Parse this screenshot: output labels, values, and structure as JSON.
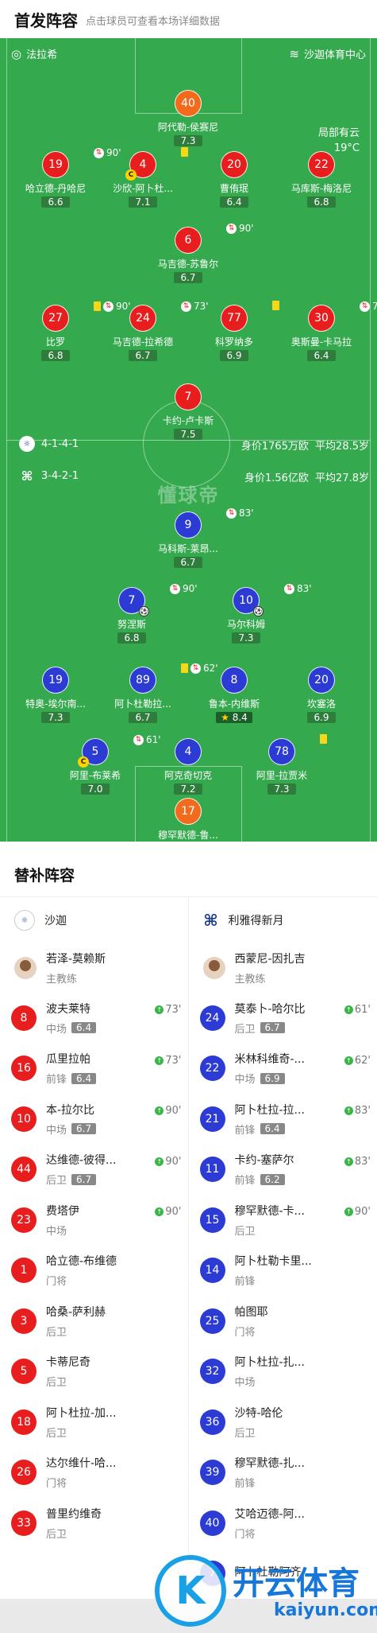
{
  "header": {
    "title": "首发阵容",
    "subtitle": "点击球员可查看本场详细数据"
  },
  "pitch": {
    "home_team_label": "法拉希",
    "venue": "沙迦体育中心",
    "weather": "局部有云",
    "temperature": "19°C",
    "watermark": "懂球帝"
  },
  "home_players": [
    {
      "num": "40",
      "name": "阿代勒-侯赛尼",
      "rating": "7.3",
      "color": "orange"
    },
    {
      "num": "19",
      "name": "哈立德-丹哈尼",
      "rating": "6.6",
      "color": "red",
      "sub": "90'"
    },
    {
      "num": "4",
      "name": "沙欣-阿卜杜...",
      "rating": "7.1",
      "color": "red",
      "yellow": true,
      "captain": "C"
    },
    {
      "num": "20",
      "name": "曹侑珉",
      "rating": "6.4",
      "color": "red"
    },
    {
      "num": "22",
      "name": "马库斯-梅洛尼",
      "rating": "6.8",
      "color": "red"
    },
    {
      "num": "6",
      "name": "马吉德-苏鲁尔",
      "rating": "6.7",
      "color": "red",
      "sub": "90'"
    },
    {
      "num": "27",
      "name": "比罗",
      "rating": "6.8",
      "color": "red",
      "yellow": true,
      "sub": "90'"
    },
    {
      "num": "24",
      "name": "马吉德-拉希德",
      "rating": "6.7",
      "color": "red",
      "sub": "73'"
    },
    {
      "num": "77",
      "name": "科罗纳多",
      "rating": "6.9",
      "color": "red",
      "yellow": true
    },
    {
      "num": "30",
      "name": "奥斯曼-卡马拉",
      "rating": "6.4",
      "color": "red",
      "sub": "73'"
    },
    {
      "num": "7",
      "name": "卡约-卢卡斯",
      "rating": "7.5",
      "color": "red"
    }
  ],
  "formations": {
    "home": {
      "formation": "4-1-4-1",
      "value": "身价1765万欧",
      "age": "平均28.5岁"
    },
    "away": {
      "formation": "3-4-2-1",
      "value": "身价1.56亿欧",
      "age": "平均27.8岁"
    }
  },
  "away_players": [
    {
      "num": "9",
      "name": "马科斯-莱昂...",
      "rating": "6.7",
      "color": "blue",
      "sub": "83'"
    },
    {
      "num": "7",
      "name": "努涅斯",
      "rating": "6.8",
      "color": "blue",
      "sub": "90'",
      "goal": true
    },
    {
      "num": "10",
      "name": "马尔科姆",
      "rating": "7.3",
      "color": "blue",
      "sub": "83'",
      "goal": true
    },
    {
      "num": "19",
      "name": "特奥-埃尔南...",
      "rating": "7.3",
      "color": "blue"
    },
    {
      "num": "89",
      "name": "阿卜杜勒拉...",
      "rating": "6.7",
      "color": "blue",
      "yellow": true,
      "sub": "62'"
    },
    {
      "num": "8",
      "name": "鲁本-内维斯",
      "rating": "8.4",
      "color": "blue",
      "star": true
    },
    {
      "num": "20",
      "name": "坎塞洛",
      "rating": "6.9",
      "color": "blue"
    },
    {
      "num": "5",
      "name": "阿里-布莱希",
      "rating": "7.0",
      "color": "blue",
      "sub": "61'",
      "captain": "C"
    },
    {
      "num": "4",
      "name": "阿克奇切克",
      "rating": "7.2",
      "color": "blue"
    },
    {
      "num": "78",
      "name": "阿里-拉贾米",
      "rating": "7.3",
      "color": "blue",
      "yellow": true
    },
    {
      "num": "17",
      "name": "穆罕默德-鲁...",
      "rating": "8.2",
      "color": "orange"
    }
  ],
  "bench": {
    "title": "替补阵容",
    "home": {
      "team": "沙迦",
      "coach": {
        "name": "若泽-莫赖斯",
        "role": "主教练"
      },
      "players": [
        {
          "num": "8",
          "name": "波夫莱特",
          "pos": "中场",
          "score": "6.4",
          "time": "73'"
        },
        {
          "num": "16",
          "name": "瓜里拉帕",
          "pos": "前锋",
          "score": "6.4",
          "time": "73'"
        },
        {
          "num": "10",
          "name": "本-拉尔比",
          "pos": "中场",
          "score": "6.7",
          "time": "90'"
        },
        {
          "num": "44",
          "name": "达维德-彼得...",
          "pos": "后卫",
          "score": "6.7",
          "time": "90'"
        },
        {
          "num": "23",
          "name": "费塔伊",
          "pos": "中场",
          "score": "",
          "time": "90'"
        },
        {
          "num": "1",
          "name": "哈立德-布维德",
          "pos": "门将",
          "score": "",
          "time": ""
        },
        {
          "num": "3",
          "name": "哈桑-萨利赫",
          "pos": "后卫",
          "score": "",
          "time": ""
        },
        {
          "num": "5",
          "name": "卡蒂尼奇",
          "pos": "后卫",
          "score": "",
          "time": ""
        },
        {
          "num": "18",
          "name": "阿卜杜拉-加...",
          "pos": "后卫",
          "score": "",
          "time": ""
        },
        {
          "num": "26",
          "name": "达尔维什-哈...",
          "pos": "门将",
          "score": "",
          "time": ""
        },
        {
          "num": "33",
          "name": "普里约维奇",
          "pos": "后卫",
          "score": "",
          "time": ""
        }
      ]
    },
    "away": {
      "team": "利雅得新月",
      "coach": {
        "name": "西蒙尼-因扎吉",
        "role": "主教练"
      },
      "players": [
        {
          "num": "24",
          "name": "莫泰卜-哈尔比",
          "pos": "后卫",
          "score": "6.7",
          "time": "61'"
        },
        {
          "num": "22",
          "name": "米林科维奇-...",
          "pos": "中场",
          "score": "6.9",
          "time": "62'"
        },
        {
          "num": "21",
          "name": "阿卜杜拉-拉...",
          "pos": "前锋",
          "score": "6.4",
          "time": "83'"
        },
        {
          "num": "11",
          "name": "卡约-塞萨尔",
          "pos": "前锋",
          "score": "6.2",
          "time": "83'"
        },
        {
          "num": "15",
          "name": "穆罕默德-卡...",
          "pos": "后卫",
          "score": "",
          "time": "90'"
        },
        {
          "num": "14",
          "name": "阿卜杜勒卡里...",
          "pos": "前锋",
          "score": "",
          "time": ""
        },
        {
          "num": "25",
          "name": "帕图耶",
          "pos": "门将",
          "score": "",
          "time": ""
        },
        {
          "num": "32",
          "name": "阿卜杜拉-扎...",
          "pos": "中场",
          "score": "",
          "time": ""
        },
        {
          "num": "36",
          "name": "沙特-哈伦",
          "pos": "后卫",
          "score": "",
          "time": ""
        },
        {
          "num": "39",
          "name": "穆罕默德-扎...",
          "pos": "前锋",
          "score": "",
          "time": ""
        },
        {
          "num": "40",
          "name": "艾哈迈德-阿...",
          "pos": "门将",
          "score": "",
          "time": ""
        },
        {
          "num": "7",
          "name": "阿卜杜勒阿齐...",
          "pos": "",
          "score": "",
          "time": ""
        }
      ]
    }
  },
  "watermark_logo": {
    "cn": "开云体育",
    "en": "kaiyun.com",
    "mark": "K"
  }
}
